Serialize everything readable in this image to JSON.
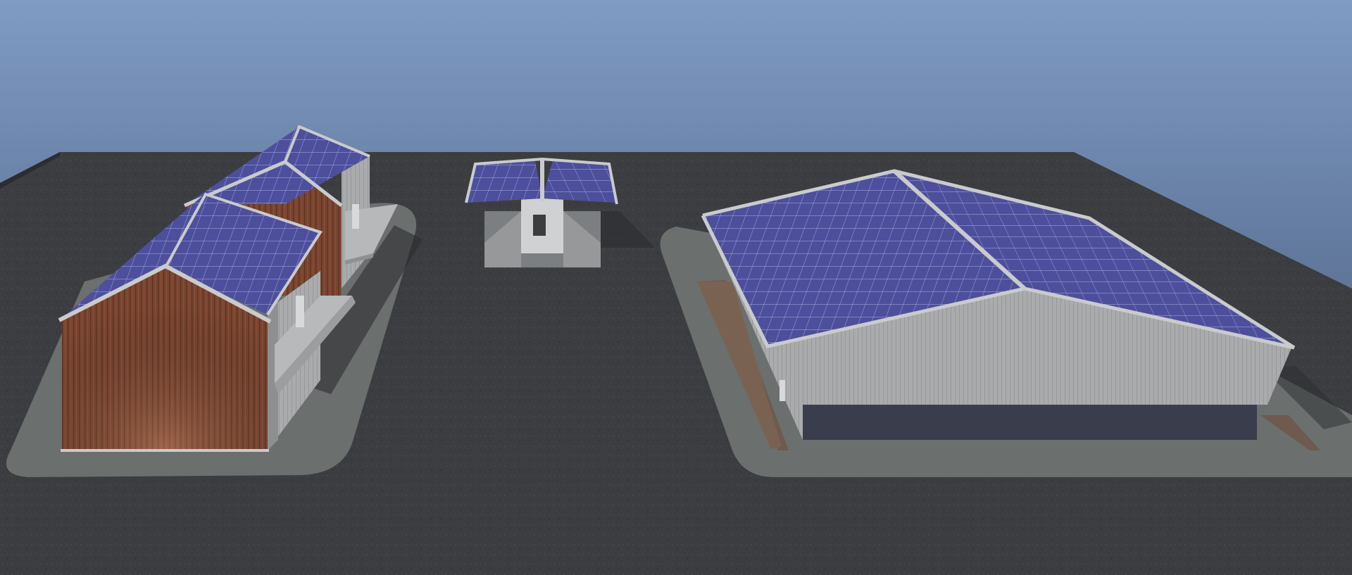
{
  "scene": {
    "sky_top_color": "#7f9bc4",
    "sky_bottom_color": "#3f4f6f",
    "ground_color": "#3c3d40",
    "pad_color": "#6b6f6e",
    "solar_panel_color": "#4d4f9c",
    "solar_grid_color": "#9ea3d8",
    "wood_siding_color": "#7a4530",
    "metal_wall_color": "#a9abad",
    "roof_trim_color": "#c9cbcc",
    "buildings": [
      {
        "kind": "gable-hall",
        "roof": "solar-panels",
        "cladding": "wood-siding"
      },
      {
        "kind": "gable-hall",
        "roof": "solar-panels",
        "cladding": "wood-siding"
      },
      {
        "kind": "canopy-pavilion",
        "roof": "solar-panels",
        "cladding": "open"
      },
      {
        "kind": "warehouse",
        "roof": "solar-panels",
        "cladding": "metal-siding"
      }
    ]
  }
}
